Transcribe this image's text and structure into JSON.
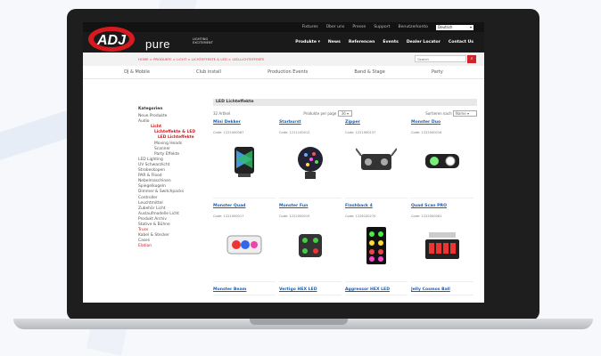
{
  "site": {
    "top_links": [
      "Fixtures",
      "Über uns",
      "Presse",
      "Support",
      "Benutzerkonto"
    ],
    "language": "Deutsch",
    "logo_text": "ADJ",
    "brand": "pure",
    "tagline_1": "LIGHTING",
    "tagline_2": "EXCITEMENT",
    "nav": [
      "Produkte ▾",
      "News",
      "Referencen",
      "Events",
      "Dealer Locator",
      "Contact Us"
    ],
    "breadcrumb": "HOME > PRODUKTE > LICHT > LICHTEFFEKTE & LED > LED-LICHTEFFEKTE",
    "search_placeholder": "Search",
    "categories": [
      "DJ & Mobile",
      "Club install",
      "Production Events",
      "Band & Stage",
      "Party"
    ]
  },
  "sidebar": {
    "heading": "Kategorien",
    "items": [
      {
        "label": "Neue Produkte",
        "level": 0
      },
      {
        "label": "Audio",
        "level": 0
      },
      {
        "label": "Licht",
        "level": 1,
        "red": true,
        "bold": true
      },
      {
        "label": "Lichteffekte & LED",
        "level": 2,
        "red": true,
        "bold": true
      },
      {
        "label": "LED Lichteffekte",
        "level": 3,
        "red": true,
        "bold": true
      },
      {
        "label": "Moving Heads",
        "level": 2
      },
      {
        "label": "Scanner",
        "level": 2
      },
      {
        "label": "Party Effekte",
        "level": 2
      },
      {
        "label": "LED Lighting",
        "level": 0
      },
      {
        "label": "UV Schwarzlicht",
        "level": 0
      },
      {
        "label": "Strobeskopen",
        "level": 0
      },
      {
        "label": "PAR & Flood",
        "level": 0
      },
      {
        "label": "Nebelmaschinen",
        "level": 0
      },
      {
        "label": "Spiegelkugeln",
        "level": 0
      },
      {
        "label": "Dimmer & Switchpacks",
        "level": 0
      },
      {
        "label": "Controller",
        "level": 0
      },
      {
        "label": "Leuchtmittel",
        "level": 0
      },
      {
        "label": "Zubehör Licht",
        "level": 0
      },
      {
        "label": "Auslaufmodelle Licht",
        "level": 0
      },
      {
        "label": "Produkt Archiv",
        "level": 0
      },
      {
        "label": "Stative & Bühne",
        "level": 0
      },
      {
        "label": "Truss",
        "level": 0,
        "red": true
      },
      {
        "label": "Kabel & Stecker",
        "level": 0
      },
      {
        "label": "Cases",
        "level": 0
      },
      {
        "label": "Elation",
        "level": 0,
        "red": true
      }
    ]
  },
  "content": {
    "heading": "LED Lichteffekte",
    "count_text": "32 Artikel",
    "per_page_label": "Produkte per page",
    "per_page_value": "36",
    "sort_label": "Sortieren nach",
    "sort_value": "Name",
    "products": [
      {
        "name": "Mini Dekker",
        "code": "Code: 1222400087",
        "icon": "dekker-icon"
      },
      {
        "name": "Starburst",
        "code": "Code: 1211100412",
        "icon": "starburst-icon"
      },
      {
        "name": "Zipper",
        "code": "Code: 1221900157",
        "icon": "zipper-icon"
      },
      {
        "name": "Monster Duo",
        "code": "Code: 1222000016",
        "icon": "duo-icon"
      },
      {
        "name": "Monster Quad",
        "code": "Code: 1222000017",
        "icon": "quad-icon"
      },
      {
        "name": "Monster Fun",
        "code": "Code: 1222000019",
        "icon": "fun-icon"
      },
      {
        "name": "Flashback 4",
        "code": "Code: 1226100270",
        "icon": "flashback-icon"
      },
      {
        "name": "Quad Scan PRO",
        "code": "Code: 1222000081",
        "icon": "scan-icon"
      },
      {
        "name": "Monster Beam",
        "code": "",
        "icon": ""
      },
      {
        "name": "Vertigo HEX LED",
        "code": "",
        "icon": ""
      },
      {
        "name": "Aggressor HEX LED",
        "code": "",
        "icon": ""
      },
      {
        "name": "Jelly Cosmos Ball",
        "code": "",
        "icon": ""
      }
    ]
  }
}
